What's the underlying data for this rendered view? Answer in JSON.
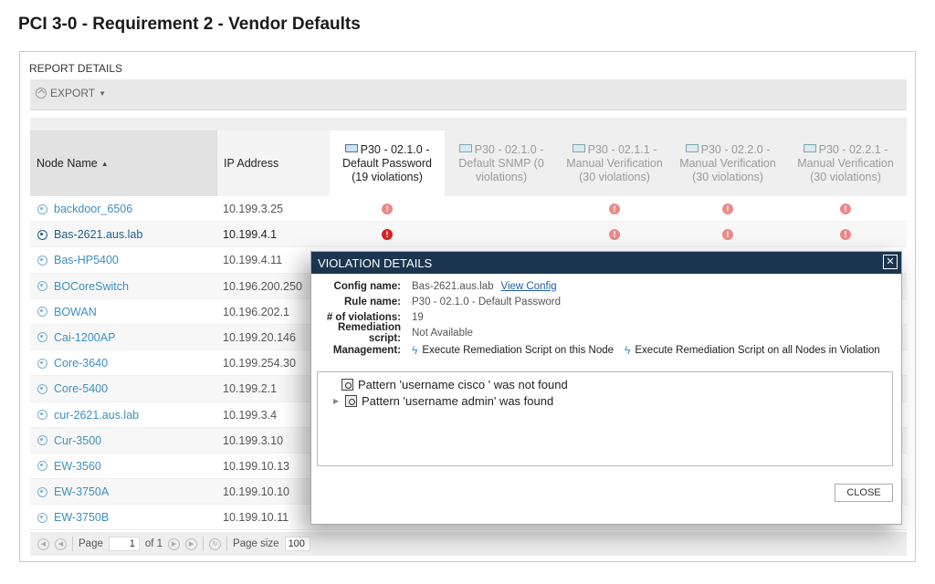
{
  "page": {
    "title": "PCI 3-0 - Requirement 2 - Vendor Defaults"
  },
  "panel": {
    "title": "REPORT DETAILS",
    "export_label": "EXPORT"
  },
  "grid": {
    "headers": {
      "node": "Node Name",
      "ip": "IP Address",
      "cols": [
        {
          "line1": "P30 - 02.1.0 -",
          "line2": "Default Password",
          "line3": "(19 violations)"
        },
        {
          "line1": "P30 - 02.1.0 -",
          "line2": "Default SNMP (0",
          "line3": "violations)"
        },
        {
          "line1": "P30 - 02.1.1 -",
          "line2": "Manual Verification",
          "line3": "(30 violations)"
        },
        {
          "line1": "P30 - 02.2.0 -",
          "line2": "Manual Verification",
          "line3": "(30 violations)"
        },
        {
          "line1": "P30 - 02.2.1 -",
          "line2": "Manual Verification",
          "line3": "(30 violations)"
        }
      ]
    },
    "rows": [
      {
        "node": "backdoor_6506",
        "ip": "10.199.3.25"
      },
      {
        "node": "Bas-2621.aus.lab",
        "ip": "10.199.4.1"
      },
      {
        "node": "Bas-HP5400",
        "ip": "10.199.4.11"
      },
      {
        "node": "BOCoreSwitch",
        "ip": "10.196.200.250"
      },
      {
        "node": "BOWAN",
        "ip": "10.196.202.1"
      },
      {
        "node": "Cai-1200AP",
        "ip": "10.199.20.146"
      },
      {
        "node": "Core-3640",
        "ip": "10.199.254.30"
      },
      {
        "node": "Core-5400",
        "ip": "10.199.2.1"
      },
      {
        "node": "cur-2621.aus.lab",
        "ip": "10.199.3.4"
      },
      {
        "node": "Cur-3500",
        "ip": "10.199.3.10"
      },
      {
        "node": "EW-3560",
        "ip": "10.199.10.13"
      },
      {
        "node": "EW-3750A",
        "ip": "10.199.10.10"
      },
      {
        "node": "EW-3750B",
        "ip": "10.199.10.11"
      }
    ],
    "violation_mark": "!"
  },
  "pager": {
    "page_label": "Page",
    "page_value": "1",
    "of_label": "of 1",
    "size_label": "Page size",
    "size_value": "100"
  },
  "modal": {
    "title": "VIOLATION DETAILS",
    "close_x": "✕",
    "config_name_label": "Config name:",
    "config_name": "Bas-2621.aus.lab",
    "view_config": "View Config",
    "rule_name_label": "Rule name:",
    "rule_name": "P30 - 02.1.0 - Default Password",
    "violations_label": "# of violations:",
    "violations": "19",
    "remediation_label": "Remediation script:",
    "remediation": "Not Available",
    "management_label": "Management:",
    "mgmt_node": "Execute Remediation Script on this Node",
    "mgmt_all": "Execute Remediation Script on all Nodes in Violation",
    "patterns": [
      "Pattern 'username cisco ' was not found",
      "Pattern 'username admin' was found"
    ],
    "close_button": "CLOSE"
  }
}
